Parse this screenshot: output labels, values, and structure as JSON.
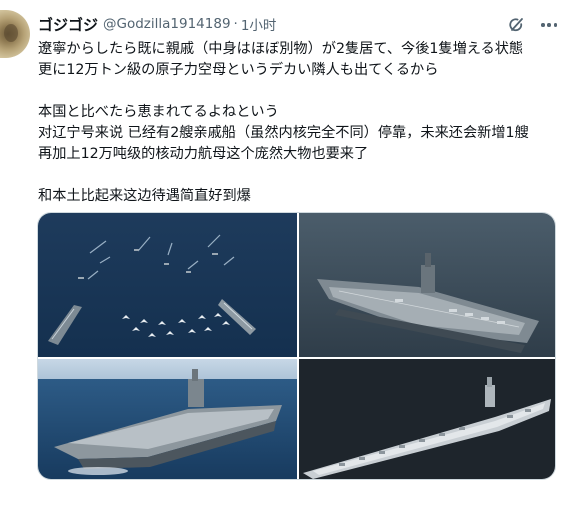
{
  "tweet": {
    "display_name": "ゴジゴジ",
    "handle": "@Godzilla1914189",
    "separator": "·",
    "time": "1小时",
    "lines": [
      "遼寧からしたら既に親戚（中身はほぼ別物）が2隻居て、今後1隻増える状態",
      "更に12万トン級の原子力空母というデカい隣人も出てくるから",
      "",
      "本国と比べたら恵まれてるよねという",
      "对辽宁号来说 已经有2艘亲戚船（虽然内核完全不同）停靠，未来还会新增1艘",
      "再加上12万吨级的核动力航母这个庞然大物也要来了",
      "",
      "和本土比起来这边待遇简直好到爆"
    ]
  },
  "icons": {
    "avatar": "avatar",
    "grok": "grok-icon",
    "more": "more-icon"
  },
  "colors": {
    "text": "#0f1419",
    "secondary": "#536471",
    "border": "#cfd9de"
  }
}
